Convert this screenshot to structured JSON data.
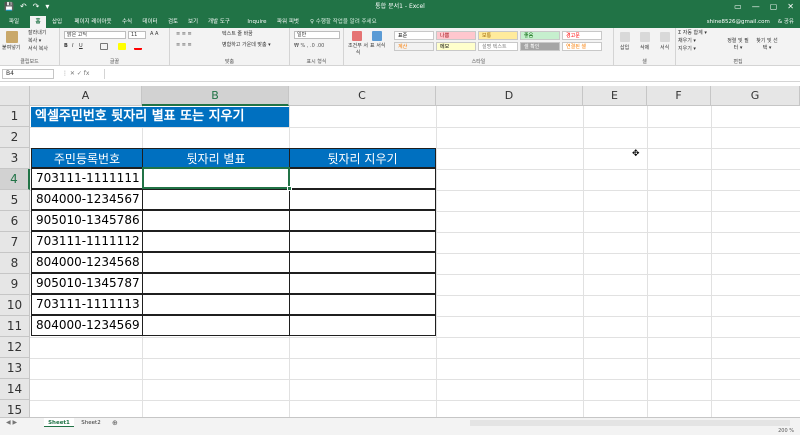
{
  "titlebar": {
    "quick_access": [
      "💾",
      "↶",
      "↷",
      "▾"
    ],
    "title": "통합 문서1 - Excel",
    "window_buttons": [
      "▭",
      "—",
      "▢",
      "✕"
    ]
  },
  "tabs": [
    "파일",
    "홈",
    "삽입",
    "페이지 레이아웃",
    "수식",
    "데이터",
    "검토",
    "보기",
    "개발 도구",
    "Inquire",
    "파워 피벗"
  ],
  "tab_search": "♀ 수행할 작업을 알려 주세요",
  "account": {
    "email": "shine8526@gmail.com",
    "share": "& 공유"
  },
  "ribbon": {
    "clipboard": {
      "paste": "붙여넣기",
      "cut": "잘라내기",
      "copy": "복사 ▾",
      "format_painter": "서식 복사",
      "label": "클립보드"
    },
    "font": {
      "name": "맑은 고딕",
      "size": "11",
      "label": "글꼴"
    },
    "alignment": {
      "wrap": "텍스트 줄 바꿈",
      "merge": "병합하고 가운데 맞춤 ▾",
      "label": "맞춤"
    },
    "number": {
      "format": "일반",
      "label": "표시 형식"
    },
    "styles": {
      "conditional": "조건부 서식",
      "table": "표 서식",
      "cells": [
        {
          "text": "표준",
          "bg": "#ffffff",
          "fg": "#000000"
        },
        {
          "text": "나쁨",
          "bg": "#ffc7ce",
          "fg": "#9c0006"
        },
        {
          "text": "보통",
          "bg": "#ffeb9c",
          "fg": "#9c6500"
        },
        {
          "text": "좋음",
          "bg": "#c6efce",
          "fg": "#006100"
        },
        {
          "text": "경고문",
          "bg": "#ffffff",
          "fg": "#ff0000"
        },
        {
          "text": "계산",
          "bg": "#f2f2f2",
          "fg": "#fa7d00"
        },
        {
          "text": "메모",
          "bg": "#ffffcc",
          "fg": "#000000"
        },
        {
          "text": "설명 텍스트",
          "bg": "#ffffff",
          "fg": "#7f7f7f"
        },
        {
          "text": "셀 확인",
          "bg": "#a5a5a5",
          "fg": "#ffffff"
        },
        {
          "text": "연결된 셀",
          "bg": "#ffffff",
          "fg": "#fa7d00"
        }
      ],
      "label": "스타일"
    },
    "cells": {
      "insert": "삽입",
      "delete": "삭제",
      "format": "서식",
      "label": "셀"
    },
    "editing": {
      "autosum": "Σ 자동 합계 ▾",
      "fill": "채우기 ▾",
      "clear": "지우기 ▾",
      "sort": "정렬 및 필터 ▾",
      "find": "찾기 및 선택 ▾",
      "label": "편집"
    }
  },
  "formula_bar": {
    "name_box": "B4",
    "icons": "⋮ ✕ ✓ fx",
    "value": ""
  },
  "columns": [
    "A",
    "B",
    "C",
    "D",
    "E",
    "F",
    "G"
  ],
  "rows": [
    "1",
    "2",
    "3",
    "4",
    "5",
    "6",
    "7",
    "8",
    "9",
    "10",
    "11",
    "12",
    "13",
    "14",
    "15"
  ],
  "selected_cell": "B4",
  "sheet": {
    "banner": "엑셀주민번호 뒷자리 별표 또는 지우기",
    "headers": [
      "주민등록번호",
      "뒷자리 별표",
      "뒷자리 지우기"
    ],
    "data": [
      "703111-1111111",
      "804000-1234567",
      "905010-1345786",
      "703111-1111112",
      "804000-1234568",
      "905010-1345787",
      "703111-1111113",
      "804000-1234569"
    ]
  },
  "sheet_tabs": [
    "Sheet1",
    "Sheet2"
  ],
  "add_sheet": "⊕",
  "status": {
    "zoom": "200 %"
  },
  "colors": {
    "excel_green": "#217346",
    "header_blue": "#0070c0"
  }
}
